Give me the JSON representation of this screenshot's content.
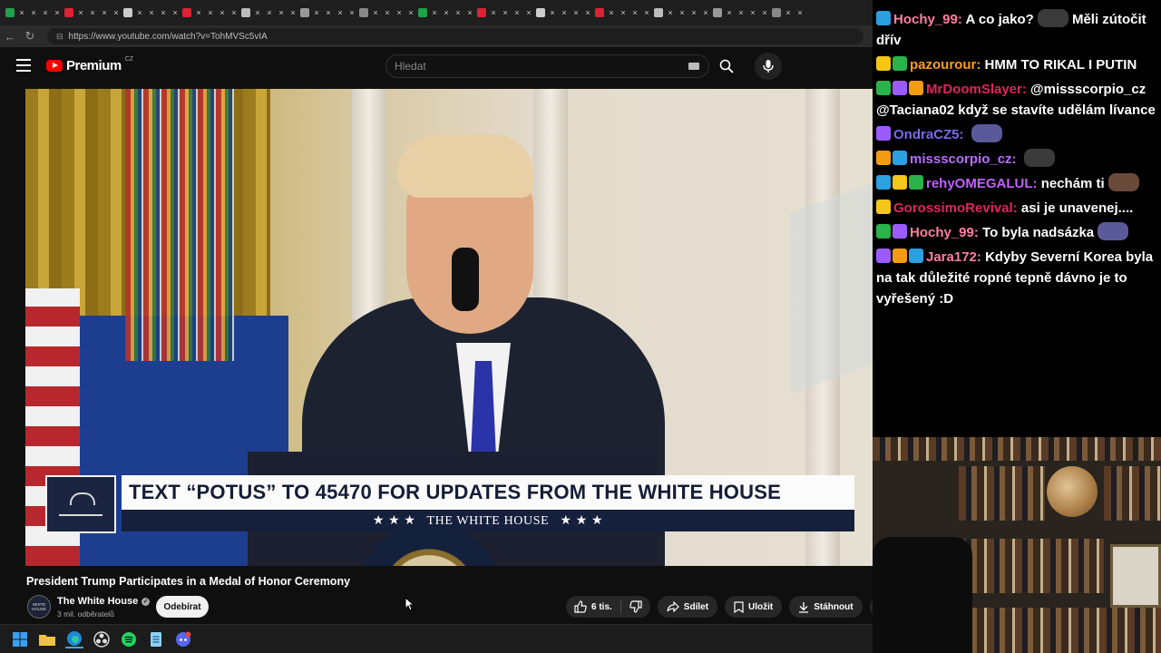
{
  "browser": {
    "url": "https://www.youtube.com/watch?v=TohMVSc5vIA",
    "tab_icons": [
      "x-icon",
      "x-icon",
      "x-icon",
      "x-icon",
      "x-icon",
      "x-icon",
      "x-icon",
      "x-icon",
      "x-icon",
      "x-icon",
      "x-icon",
      "x-icon",
      "x-icon",
      "x-icon",
      "x-icon",
      "x-icon",
      "x-icon",
      "x-icon",
      "x-icon",
      "x-icon",
      "x-icon",
      "x-icon",
      "x-icon",
      "x-icon",
      "x-icon",
      "x-icon",
      "x-icon",
      "x-icon",
      "x-icon",
      "x-icon",
      "x-icon",
      "x-icon",
      "x-icon",
      "x-icon",
      "x-icon",
      "x-icon",
      "x-icon",
      "x-icon",
      "x-icon",
      "x-icon",
      "x-icon",
      "x-icon",
      "x-icon",
      "x-icon",
      "x-icon",
      "x-icon",
      "x-icon",
      "x-icon",
      "x-icon",
      "x-icon",
      "x-icon",
      "x-icon",
      "x-icon",
      "x-icon",
      "x-icon",
      "x-icon",
      "x-icon",
      "x-icon",
      "x-icon",
      "x-icon",
      "x-icon",
      "x-icon",
      "x-icon",
      "x-icon",
      "x-icon",
      "x-icon",
      "x-icon",
      "x-icon",
      "x-icon",
      "x-icon",
      "x-icon",
      "x-icon"
    ]
  },
  "youtube": {
    "logo_text": "Premium",
    "logo_country": "CZ",
    "search_placeholder": "Hledat",
    "accent": "#ff0000"
  },
  "video": {
    "lower_third_main": "TEXT “POTUS” TO 45470 FOR UPDATES FROM THE WHITE HOUSE",
    "lower_third_sub": "★ ★ ★   THE WHITE HOUSE   ★ ★ ★",
    "title": "President Trump Participates in a Medal of Honor Ceremony"
  },
  "channel": {
    "name": "The White House",
    "subscribers": "3 mil. odběratelů",
    "avatar_text": "WHITE HOUSE",
    "subscribe_label": "Odebírat"
  },
  "actions": {
    "like_count": "6 tis.",
    "share_label": "Sdílet",
    "save_label": "Uložit",
    "download_label": "Stáhnout"
  },
  "chat": {
    "messages": [
      {
        "user": "Hochy_99",
        "color": "#ff7f9f",
        "text": "A co jako?",
        "text_after": "Měli zútočit dřív"
      },
      {
        "user": "pazourour",
        "color": "#ff9f1c",
        "text": "HMM TO RIKAL I PUTIN"
      },
      {
        "user": "MrDoomSlayer",
        "color": "#e0245e",
        "text": "@missscorpio_cz @Taciana02 když se stavíte udělám lívance"
      },
      {
        "user": "OndraCZ5",
        "color": "#7b68ee",
        "text": ""
      },
      {
        "user": "missscorpio_cz",
        "color": "#b86cff",
        "text": ""
      },
      {
        "user": "rehyOMEGALUL",
        "color": "#c061ff",
        "text": "nechám ti"
      },
      {
        "user": "GorossimoRevival",
        "color": "#e0245e",
        "text": "asi je unavenej...."
      },
      {
        "user": "Hochy_99",
        "color": "#ff7f9f",
        "text": "To byla nadsázka"
      },
      {
        "user": "Jara172",
        "color": "#ff7f9f",
        "text": "Kdyby Severní Korea byla na tak důležité ropné tepně dávno je to vyřešený :D"
      }
    ]
  }
}
